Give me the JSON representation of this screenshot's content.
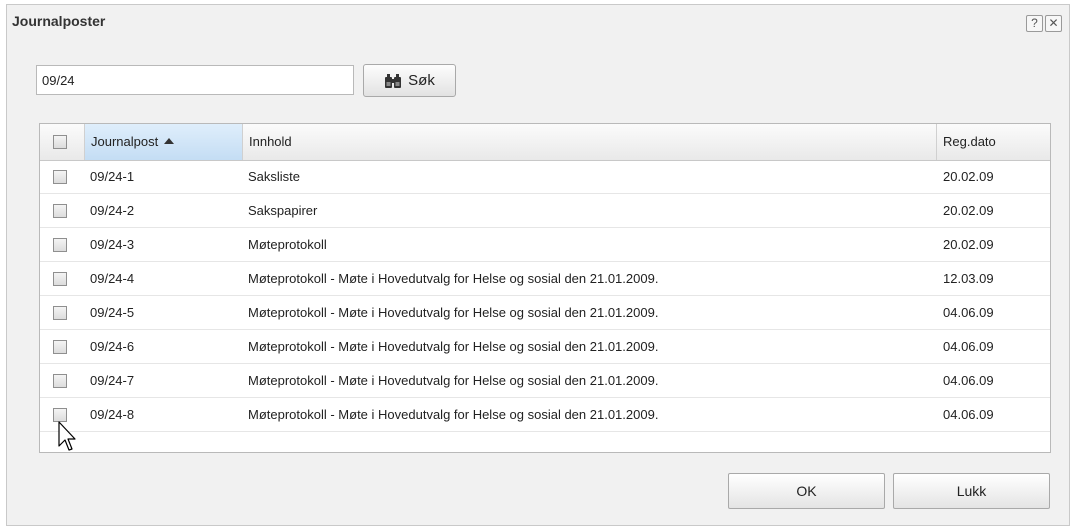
{
  "dialog": {
    "title": "Journalposter",
    "help_label": "?",
    "close_label": "✕"
  },
  "search": {
    "value": "09/24",
    "button_label": "Søk"
  },
  "table": {
    "columns": [
      "Journalpost",
      "Innhold",
      "Reg.dato"
    ],
    "sorted_column": "Journalpost",
    "sort_direction": "ascending",
    "rows": [
      {
        "journalpost": "09/24-1",
        "innhold": "Saksliste",
        "regdato": "20.02.09",
        "checked": false
      },
      {
        "journalpost": "09/24-2",
        "innhold": "Sakspapirer",
        "regdato": "20.02.09",
        "checked": false
      },
      {
        "journalpost": "09/24-3",
        "innhold": "Møteprotokoll",
        "regdato": "20.02.09",
        "checked": false
      },
      {
        "journalpost": "09/24-4",
        "innhold": "Møteprotokoll - Møte i Hovedutvalg for Helse og sosial den 21.01.2009.",
        "regdato": "12.03.09",
        "checked": false
      },
      {
        "journalpost": "09/24-5",
        "innhold": "Møteprotokoll - Møte i Hovedutvalg for Helse og sosial den 21.01.2009.",
        "regdato": "04.06.09",
        "checked": false
      },
      {
        "journalpost": "09/24-6",
        "innhold": "Møteprotokoll - Møte i Hovedutvalg for Helse og sosial den 21.01.2009.",
        "regdato": "04.06.09",
        "checked": false
      },
      {
        "journalpost": "09/24-7",
        "innhold": "Møteprotokoll - Møte i Hovedutvalg for Helse og sosial den 21.01.2009.",
        "regdato": "04.06.09",
        "checked": false
      },
      {
        "journalpost": "09/24-8",
        "innhold": "Møteprotokoll - Møte i Hovedutvalg for Helse og sosial den 21.01.2009.",
        "regdato": "04.06.09",
        "checked": false
      }
    ]
  },
  "footer": {
    "ok_label": "OK",
    "close_label": "Lukk"
  },
  "icons": {
    "search": "binoculars-icon",
    "sort": "sort-ascending-icon",
    "cursor": "mouse-pointer-icon"
  }
}
